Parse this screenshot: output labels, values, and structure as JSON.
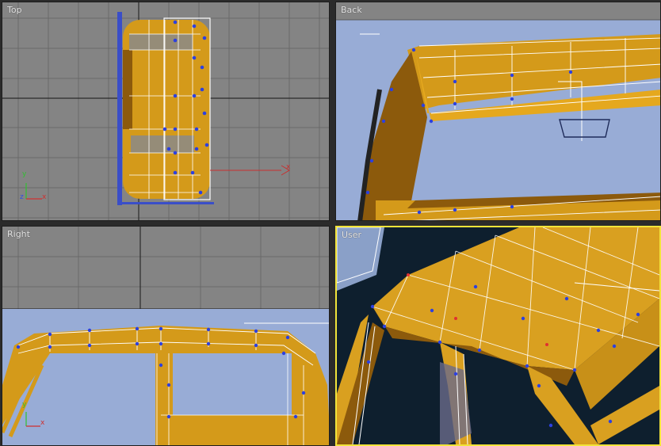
{
  "viewports": {
    "top": {
      "label": "Top",
      "axis_x": "x",
      "axis_y": "y",
      "axis_z": "z"
    },
    "back": {
      "label": "Back"
    },
    "right": {
      "label": "Right",
      "axis_x": "x",
      "axis_y": "y"
    },
    "user": {
      "label": "User"
    }
  },
  "colors": {
    "viewport_bg": "#848484",
    "grid": "#6a6a6a",
    "blueprint": "#98acd6",
    "mesh_fill": "#d49a1a",
    "mesh_dark": "#8c5a0c",
    "wire": "#ffffff",
    "vertex": "#2c40e0",
    "active_border": "#f2e43a",
    "axis_x": "#d03030",
    "axis_y": "#30c030",
    "axis_z": "#3050e0"
  }
}
